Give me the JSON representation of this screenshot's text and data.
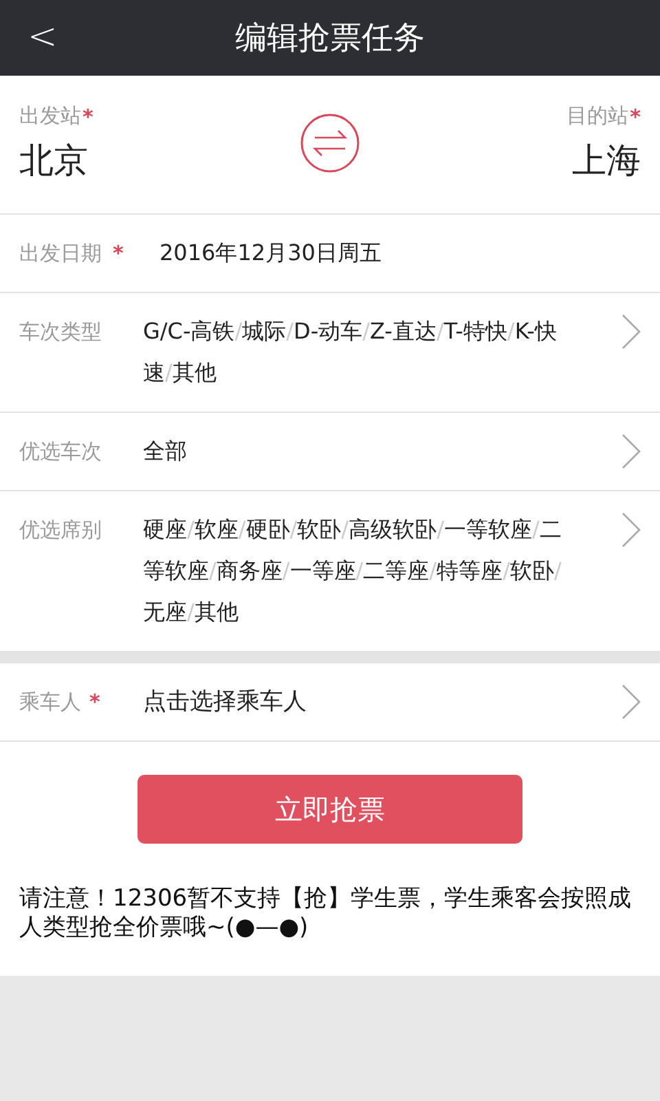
{
  "header": {
    "back": "<",
    "title": "编辑抢票任务"
  },
  "required_mark": "*",
  "stations": {
    "from": {
      "label": "出发站",
      "required": true,
      "value": "北京"
    },
    "to": {
      "label": "目的站",
      "required": true,
      "value": "上海"
    }
  },
  "date": {
    "label": "出发日期",
    "required": true,
    "value": "2016年12月30日周五"
  },
  "separator": "/",
  "options": [
    {
      "label": "车次类型",
      "items": [
        "G/C-高铁",
        "城际",
        "D-动车",
        "Z-直达",
        "T-特快",
        "K-快速",
        "其他"
      ]
    },
    {
      "label": "优选车次",
      "items": [
        "全部"
      ]
    },
    {
      "label": "优选席别",
      "items": [
        "硬座",
        "软座",
        "硬卧",
        "软卧",
        "高级软卧",
        "一等软座",
        "二等软座",
        "商务座",
        "一等座",
        "二等座",
        "特等座",
        "软卧",
        "无座",
        "其他"
      ]
    }
  ],
  "passenger": {
    "label": "乘车人",
    "required": true,
    "placeholder": "点击选择乘车人"
  },
  "submit_button": "立即抢票",
  "notice": "请注意！12306暂不支持【抢】学生票，学生乘客会按照成人类型抢全价票哦~(●—●)"
}
